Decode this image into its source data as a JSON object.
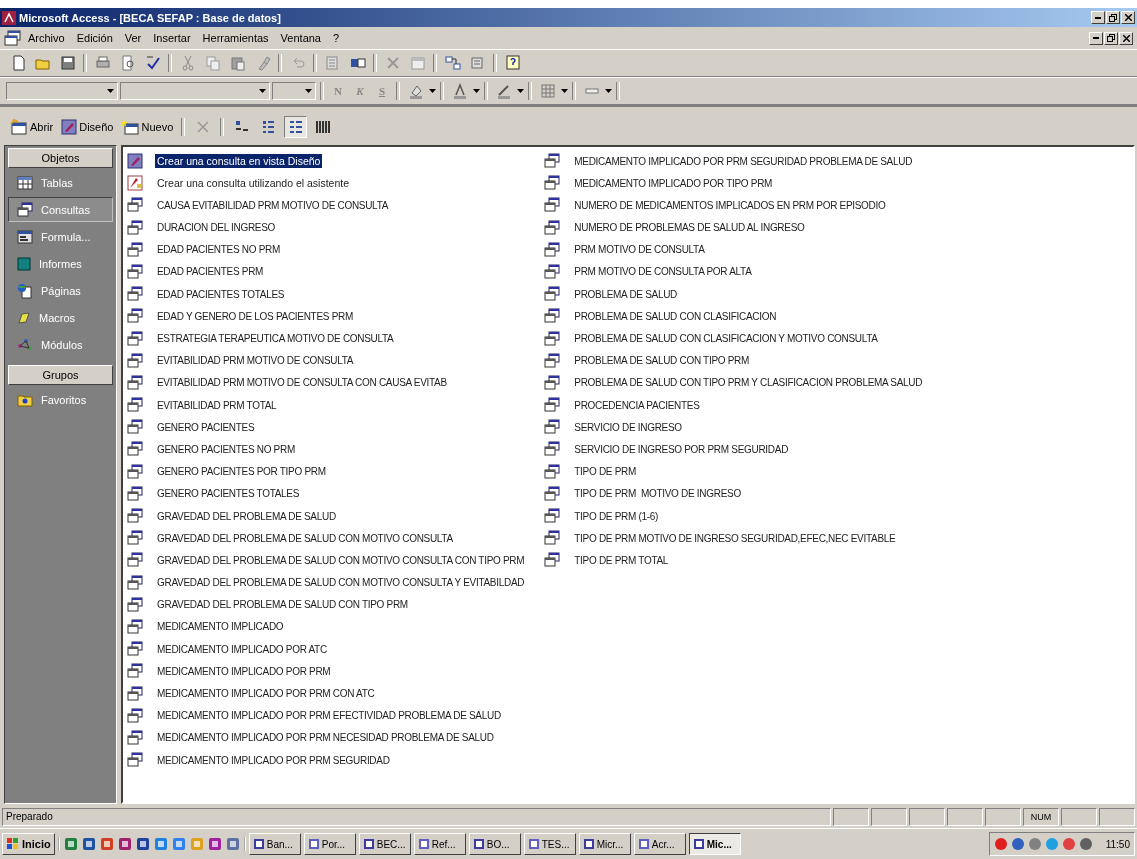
{
  "window": {
    "title": "Microsoft Access - [BECA SEFAP : Base de datos]"
  },
  "menu": [
    "Archivo",
    "Edición",
    "Ver",
    "Insertar",
    "Herramientas",
    "Ventana",
    "?"
  ],
  "format_toolbar": {
    "text_buttons": [
      {
        "label": "N",
        "kind": "bold"
      },
      {
        "label": "K",
        "kind": "italic"
      },
      {
        "label": "S",
        "kind": "underline"
      }
    ]
  },
  "db_toolbar": {
    "buttons": [
      {
        "label": "Abrir",
        "kind": "open"
      },
      {
        "label": "Diseño",
        "kind": "design"
      },
      {
        "label": "Nuevo",
        "kind": "new"
      }
    ],
    "views": [
      {
        "kind": "large",
        "selected": false
      },
      {
        "kind": "small",
        "selected": false
      },
      {
        "kind": "list",
        "selected": true
      },
      {
        "kind": "details",
        "selected": false
      }
    ]
  },
  "sidebar": {
    "sections": [
      {
        "header": "Objetos",
        "items": [
          {
            "label": "Tablas",
            "kind": "table",
            "selected": false
          },
          {
            "label": "Consultas",
            "kind": "query",
            "selected": true
          },
          {
            "label": "Formula...",
            "kind": "form",
            "selected": false
          },
          {
            "label": "Informes",
            "kind": "report",
            "selected": false
          },
          {
            "label": "Páginas",
            "kind": "page",
            "selected": false
          },
          {
            "label": "Macros",
            "kind": "macro",
            "selected": false
          },
          {
            "label": "Módulos",
            "kind": "module",
            "selected": false
          }
        ]
      },
      {
        "header": "Grupos",
        "items": [
          {
            "label": "Favoritos",
            "kind": "folder",
            "selected": false
          }
        ]
      }
    ]
  },
  "items": [
    {
      "label": "Crear una consulta en vista Diseño",
      "kind": "design",
      "selected": true
    },
    {
      "label": "Crear una consulta utilizando el asistente",
      "kind": "wizard",
      "selected": false
    },
    {
      "label": "CAUSA EVITABILIDAD PRM MOTIVO DE CONSULTA",
      "kind": "query",
      "selected": false
    },
    {
      "label": "DURACION DEL INGRESO",
      "kind": "query",
      "selected": false
    },
    {
      "label": "EDAD PACIENTES NO PRM",
      "kind": "query",
      "selected": false
    },
    {
      "label": "EDAD PACIENTES PRM",
      "kind": "query",
      "selected": false
    },
    {
      "label": "EDAD PACIENTES TOTALES",
      "kind": "query",
      "selected": false
    },
    {
      "label": "EDAD Y GENERO DE LOS PACIENTES PRM",
      "kind": "query",
      "selected": false
    },
    {
      "label": "ESTRATEGIA TERAPEUTICA MOTIVO DE CONSULTA",
      "kind": "query",
      "selected": false
    },
    {
      "label": "EVITABILIDAD PRM MOTIVO DE CONSULTA",
      "kind": "query",
      "selected": false
    },
    {
      "label": "EVITABILIDAD PRM MOTIVO DE CONSULTA CON CAUSA EVITAB",
      "kind": "query",
      "selected": false
    },
    {
      "label": "EVITABILIDAD PRM TOTAL",
      "kind": "query",
      "selected": false
    },
    {
      "label": "GENERO PACIENTES",
      "kind": "query",
      "selected": false
    },
    {
      "label": "GENERO PACIENTES NO PRM",
      "kind": "query",
      "selected": false
    },
    {
      "label": "GENERO PACIENTES POR TIPO PRM",
      "kind": "query",
      "selected": false
    },
    {
      "label": "GENERO PACIENTES TOTALES",
      "kind": "query",
      "selected": false
    },
    {
      "label": "GRAVEDAD DEL PROBLEMA DE SALUD",
      "kind": "query",
      "selected": false
    },
    {
      "label": "GRAVEDAD DEL PROBLEMA DE SALUD CON MOTIVO CONSULTA",
      "kind": "query",
      "selected": false
    },
    {
      "label": "GRAVEDAD DEL PROBLEMA DE SALUD CON MOTIVO CONSULTA CON TIPO PRM",
      "kind": "query",
      "selected": false
    },
    {
      "label": "GRAVEDAD DEL PROBLEMA DE SALUD CON MOTIVO CONSULTA Y EVITABILDAD",
      "kind": "query",
      "selected": false
    },
    {
      "label": "GRAVEDAD DEL PROBLEMA DE SALUD CON TIPO PRM",
      "kind": "query",
      "selected": false
    },
    {
      "label": "MEDICAMENTO IMPLICADO",
      "kind": "query",
      "selected": false
    },
    {
      "label": "MEDICAMENTO IMPLICADO POR ATC",
      "kind": "query",
      "selected": false
    },
    {
      "label": "MEDICAMENTO IMPLICADO POR PRM",
      "kind": "query",
      "selected": false
    },
    {
      "label": "MEDICAMENTO IMPLICADO POR PRM CON ATC",
      "kind": "query",
      "selected": false
    },
    {
      "label": "MEDICAMENTO IMPLICADO POR PRM EFECTIVIDAD PROBLEMA DE SALUD",
      "kind": "query",
      "selected": false
    },
    {
      "label": "MEDICAMENTO IMPLICADO POR PRM NECESIDAD PROBLEMA DE SALUD",
      "kind": "query",
      "selected": false
    },
    {
      "label": "MEDICAMENTO IMPLICADO POR PRM SEGURIDAD",
      "kind": "query",
      "selected": false
    },
    {
      "label": "MEDICAMENTO IMPLICADO POR PRM SEGURIDAD PROBLEMA DE SALUD",
      "kind": "query",
      "selected": false
    },
    {
      "label": "MEDICAMENTO IMPLICADO POR TIPO PRM",
      "kind": "query",
      "selected": false
    },
    {
      "label": "NUMERO DE MEDICAMENTOS IMPLICADOS EN PRM POR EPISODIO",
      "kind": "query",
      "selected": false
    },
    {
      "label": "NUMERO DE PROBLEMAS DE SALUD AL INGRESO",
      "kind": "query",
      "selected": false
    },
    {
      "label": "PRM MOTIVO DE CONSULTA",
      "kind": "query",
      "selected": false
    },
    {
      "label": "PRM MOTIVO DE CONSULTA POR ALTA",
      "kind": "query",
      "selected": false
    },
    {
      "label": "PROBLEMA DE SALUD",
      "kind": "query",
      "selected": false
    },
    {
      "label": "PROBLEMA DE SALUD CON CLASIFICACION",
      "kind": "query",
      "selected": false
    },
    {
      "label": "PROBLEMA DE SALUD CON CLASIFICACION Y MOTIVO CONSULTA",
      "kind": "query",
      "selected": false
    },
    {
      "label": "PROBLEMA DE SALUD CON TIPO PRM",
      "kind": "query",
      "selected": false
    },
    {
      "label": "PROBLEMA DE SALUD CON TIPO PRM Y CLASIFICACION PROBLEMA SALUD",
      "kind": "query",
      "selected": false
    },
    {
      "label": "PROCEDENCIA PACIENTES",
      "kind": "query",
      "selected": false
    },
    {
      "label": "SERVICIO DE INGRESO",
      "kind": "query",
      "selected": false
    },
    {
      "label": "SERVICIO DE INGRESO POR PRM SEGURIDAD",
      "kind": "query",
      "selected": false
    },
    {
      "label": "TIPO DE PRM",
      "kind": "query",
      "selected": false
    },
    {
      "label": "TIPO DE PRM  MOTIVO DE INGRESO",
      "kind": "query",
      "selected": false
    },
    {
      "label": "TIPO DE PRM (1-6)",
      "kind": "query",
      "selected": false
    },
    {
      "label": "TIPO DE PRM MOTIVO DE INGRESO SEGURIDAD,EFEC,NEC EVITABLE",
      "kind": "query",
      "selected": false
    },
    {
      "label": "TIPO DE PRM TOTAL",
      "kind": "query",
      "selected": false
    }
  ],
  "status_bar": {
    "text": "Preparado",
    "indicator": "NUM"
  },
  "taskbar": {
    "start": "Inicio",
    "tasks": [
      {
        "label": "Ban...",
        "selected": false
      },
      {
        "label": "Por...",
        "selected": false
      },
      {
        "label": "BEC...",
        "selected": false
      },
      {
        "label": "Ref...",
        "selected": false
      },
      {
        "label": "BO...",
        "selected": false
      },
      {
        "label": "TES...",
        "selected": false
      },
      {
        "label": "Micr...",
        "selected": false
      },
      {
        "label": "Acr...",
        "selected": false
      },
      {
        "label": "Mic...",
        "selected": true
      }
    ],
    "clock": "11:50"
  }
}
